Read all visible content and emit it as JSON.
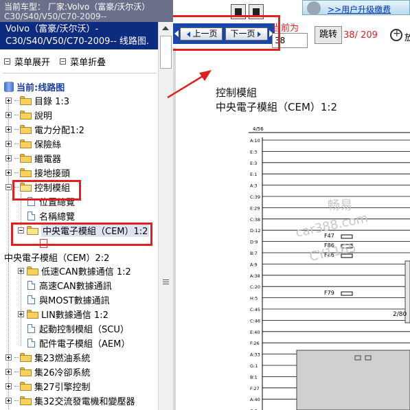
{
  "window": {
    "header_line1": "当前车型： 厂家:Volvo（富豪/沃尔沃）",
    "header_line2": "C30/S40/V50/C70-2009--"
  },
  "title_bar": {
    "line1": "Volvo（富豪/沃尔沃）-",
    "line2": "C30/S40/V50/C70-2009-- 线路图."
  },
  "menu": {
    "expand_label": "菜单展开",
    "collapse_label": "菜单折叠"
  },
  "tree": {
    "current_label": "当前:线路图",
    "items": [
      {
        "label": "目錄 1:3"
      },
      {
        "label": "說明"
      },
      {
        "label": "電力分配1:2"
      },
      {
        "label": "保險絲"
      },
      {
        "label": "繼電器"
      },
      {
        "label": "接地接頭"
      },
      {
        "label": "控制模組"
      },
      {
        "label": "位置總覽"
      },
      {
        "label": "名稱總覽"
      },
      {
        "label": "中央電子模組（CEM）1:2"
      },
      {
        "label": "中央電子模組（CEM）2:2"
      },
      {
        "label": "低速CAN數據通信 1:2"
      },
      {
        "label": "高速CAN數據通訊"
      },
      {
        "label": "與MOST數據通訊"
      },
      {
        "label": "LIN數據通信 1:2"
      },
      {
        "label": "起動控制模組（SCU）"
      },
      {
        "label": "配件電子模組（AEM）"
      },
      {
        "label": "集23燃油系統"
      },
      {
        "label": "集26冷卻系統"
      },
      {
        "label": "集27引擎控制"
      },
      {
        "label": "集32交流發電機和變壓器"
      }
    ]
  },
  "toolbar": {
    "prev_label": "上一页",
    "next_label": "下一页",
    "page_label": "当前为",
    "page_value": "38",
    "jump_label": "跳转",
    "page_count": "38/ 209",
    "zoom_label": "放",
    "upgrade_link": ">>用户升级缴费"
  },
  "diagram": {
    "title_line1": "控制模組",
    "title_line2": "中央電子模組（CEM）1:2",
    "page_ref": "4/56",
    "pin_labels": [
      "A:10",
      "E:3",
      "E:3",
      "E:1",
      "A:3",
      "C:39",
      "E:29",
      "C:38",
      "D:12",
      "D:9",
      "B:7",
      "A:9",
      "A:38",
      "C:20",
      "H:5",
      "C:45",
      "C:46",
      "E:40",
      "F:26",
      "A:33",
      "G:1",
      "B:1",
      "F:27",
      "A:40",
      "C:9",
      "G:3"
    ],
    "fuses": [
      "F47",
      "F86",
      "F46",
      "F79"
    ],
    "ref_2_80": "2/80",
    "watermark_line1": "畅易",
    "watermark_line2": "car388.com",
    "watermark_line3": "CY1165"
  },
  "colors": {
    "title_bar": "#0d2c80",
    "nav_strip": "#1a46a8",
    "highlight_red": "#e02020"
  },
  "icons": [
    "folder-icon",
    "document-icon",
    "expand-plus-icon",
    "collapse-minus-icon",
    "database-icon",
    "zoom-in-icon",
    "arrow-left-icon",
    "arrow-right-icon"
  ]
}
